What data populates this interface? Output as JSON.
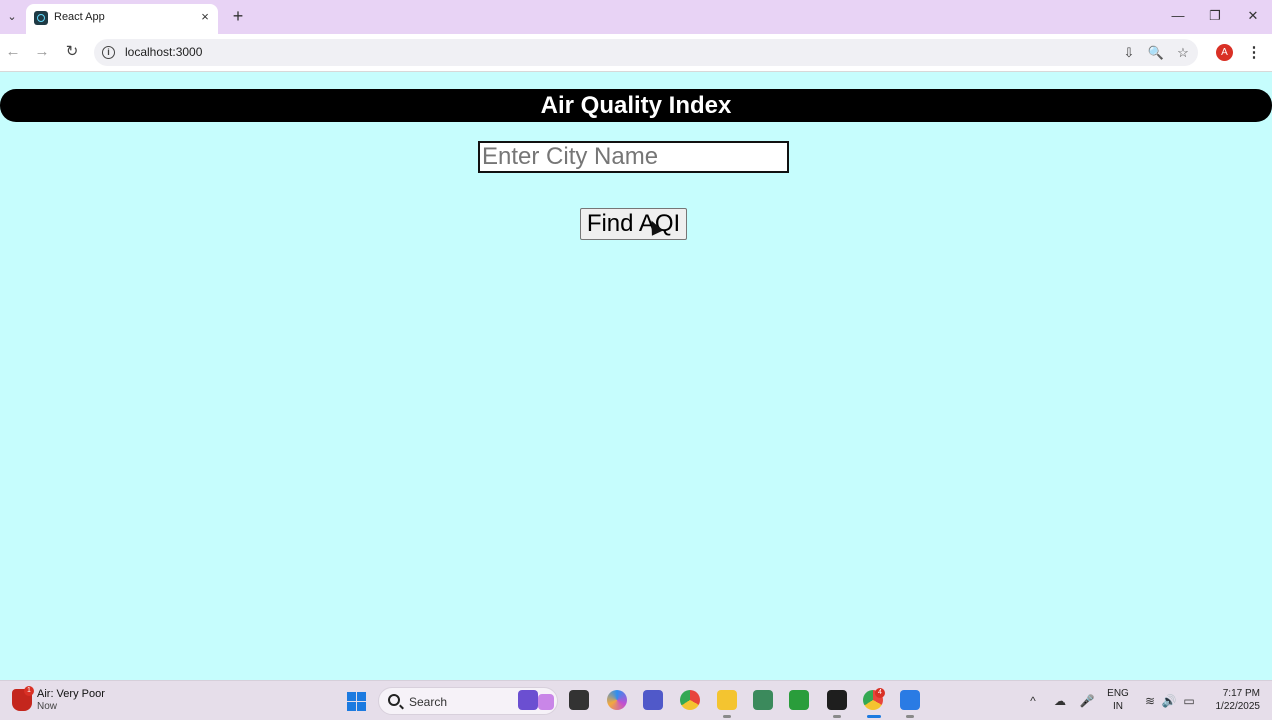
{
  "browser": {
    "tab": {
      "title": "React App",
      "close": "×"
    },
    "new_tab": "+",
    "window": {
      "minimize": "—",
      "restore": "❐",
      "close": "✕"
    },
    "url": "localhost:3000",
    "profile_initial": "A",
    "nav": {
      "back": "←",
      "forward": "→",
      "reload": "↻"
    },
    "menu": "⋮",
    "icons": {
      "install": "⇩",
      "zoom": "🔍",
      "bookmark": "☆",
      "info": "i",
      "tab_list": "⌄"
    }
  },
  "page": {
    "title": "Air Quality Index",
    "city_input": {
      "placeholder": "Enter City Name",
      "value": ""
    },
    "find_button": "Find AQI"
  },
  "taskbar": {
    "weather": {
      "title": "Air: Very Poor",
      "subtitle": "Now",
      "badge": "1"
    },
    "search_label": "Search",
    "apps": [
      {
        "name": "copilot-app-icon",
        "color": "#6b4fd1"
      },
      {
        "name": "media-app-icon",
        "color": "#c34fd1"
      },
      {
        "name": "task-view-icon",
        "color": "#333333"
      },
      {
        "name": "copilot-colorful-icon",
        "color": "#2e8ef0"
      },
      {
        "name": "teams-icon",
        "color": "#5059c9"
      },
      {
        "name": "chrome-icon",
        "color": "#e8453c"
      },
      {
        "name": "file-explorer-icon",
        "color": "#f4c430"
      },
      {
        "name": "network-app-icon",
        "color": "#3b8a5c"
      },
      {
        "name": "image-editor-icon",
        "color": "#2a9d3b"
      },
      {
        "name": "terminal-icon",
        "color": "#1e1e1e"
      },
      {
        "name": "chrome-active-icon",
        "color": "#e8453c"
      },
      {
        "name": "snipping-tool-icon",
        "color": "#2a7be4"
      }
    ],
    "chrome_badge": "4",
    "tray": {
      "chevron": "^",
      "language_line1": "ENG",
      "language_line2": "IN",
      "wifi": "≋",
      "volume": "🔊",
      "battery": "▭",
      "mic": "🎤",
      "cloud": "☁"
    },
    "clock": {
      "time": "7:17 PM",
      "date": "1/22/2025"
    }
  }
}
